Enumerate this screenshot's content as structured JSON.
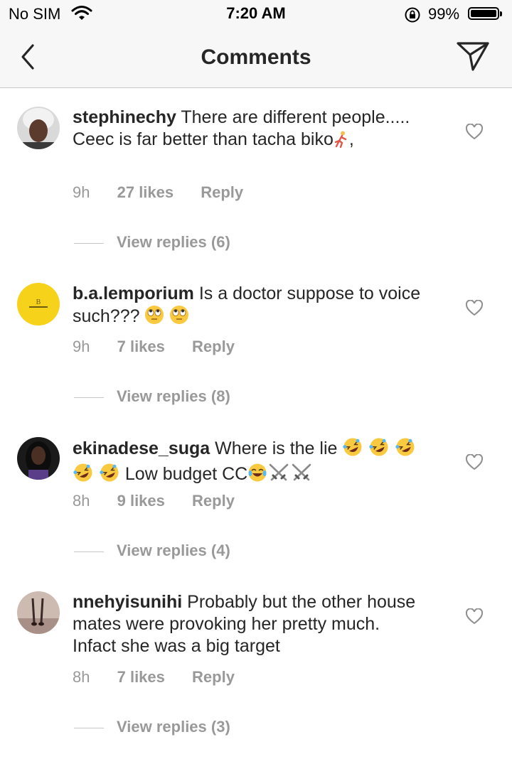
{
  "status_bar": {
    "carrier": "No SIM",
    "time": "7:20 AM",
    "battery": "99%",
    "battery_level": 0.99
  },
  "nav": {
    "title": "Comments",
    "back_icon": "chevron-left-icon",
    "send_icon": "paper-plane-icon"
  },
  "comments": [
    {
      "username": "stephinechy",
      "text": "There are different people..... Ceec is far better than tacha biko",
      "time": "9h",
      "likes": "27 likes",
      "reply": "Reply",
      "view_replies": "View replies (6)"
    },
    {
      "username": "b.a.lemporium",
      "text": "Is a doctor suppose to voice such???",
      "time": "9h",
      "likes": "7 likes",
      "reply": "Reply",
      "view_replies": "View replies (8)"
    },
    {
      "username": "ekinadese_suga",
      "text": "Where is the lie",
      "text_after": "Low budget CC",
      "time": "8h",
      "likes": "9 likes",
      "reply": "Reply",
      "view_replies": "View replies (4)"
    },
    {
      "username": "nnehyisunihi",
      "text": "Probably but the other house mates were provoking her pretty much. Infact she was a big target",
      "time": "8h",
      "likes": "7 likes",
      "reply": "Reply",
      "view_replies": "View replies (3)"
    }
  ],
  "colors": {
    "text": "#262626",
    "meta": "#999999",
    "bar_bg": "#f7f7f7",
    "avatar_yellow": "#f7d21a"
  }
}
